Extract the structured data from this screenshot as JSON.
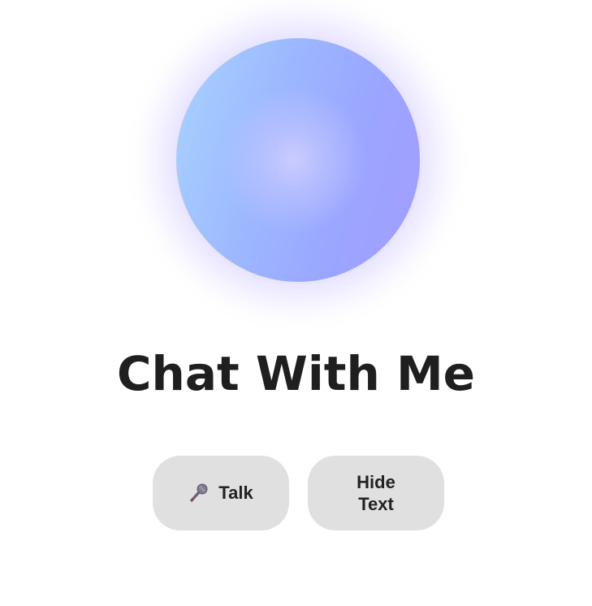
{
  "page": {
    "title": "Chat With Me"
  },
  "orb": {
    "colors": [
      "#a7d3ff",
      "#9db8ff",
      "#a49cff"
    ]
  },
  "buttons": {
    "talk": {
      "icon": "microphone-icon",
      "label": "Talk"
    },
    "hide_text": {
      "label": "Hide Text"
    }
  },
  "colors": {
    "button_bg": "#e0e0e0",
    "title_text": "#1f1f1f"
  }
}
